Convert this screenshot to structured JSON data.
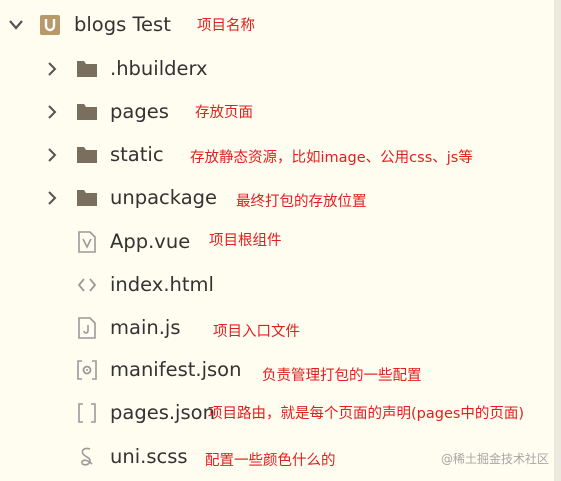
{
  "project": {
    "name": "blogs Test",
    "icon": "uni-app-project-icon",
    "note": "项目名称"
  },
  "items": [
    {
      "label": ".hbuilderx",
      "type": "folder",
      "icon": "folder-icon",
      "note": ""
    },
    {
      "label": "pages",
      "type": "folder",
      "icon": "folder-icon",
      "note": "存放页面"
    },
    {
      "label": "static",
      "type": "folder",
      "icon": "folder-icon",
      "note": "存放静态资源，比如image、公用css、js等"
    },
    {
      "label": "unpackage",
      "type": "folder",
      "icon": "folder-icon",
      "note": "最终打包的存放位置"
    },
    {
      "label": "App.vue",
      "type": "file",
      "icon": "vue-file-icon",
      "note": "项目根组件"
    },
    {
      "label": "index.html",
      "type": "file",
      "icon": "html-file-icon",
      "note": ""
    },
    {
      "label": "main.js",
      "type": "file",
      "icon": "js-file-icon",
      "note": "项目入口文件"
    },
    {
      "label": "manifest.json",
      "type": "file",
      "icon": "manifest-file-icon",
      "note": "负责管理打包的一些配置"
    },
    {
      "label": "pages.json",
      "type": "file",
      "icon": "json-file-icon",
      "note": "项目路由，就是每个页面的声明(pages中的页面)"
    },
    {
      "label": "uni.scss",
      "type": "file",
      "icon": "scss-file-icon",
      "note": "配置一些颜色什么的"
    }
  ],
  "watermark": "@稀土掘金技术社区",
  "colors": {
    "background": "#fffcf0",
    "annotation": "#e31e1e",
    "folder": "#7a6e5e",
    "icon_gray": "#9a9a9a",
    "project_icon": "#b89a6a"
  }
}
